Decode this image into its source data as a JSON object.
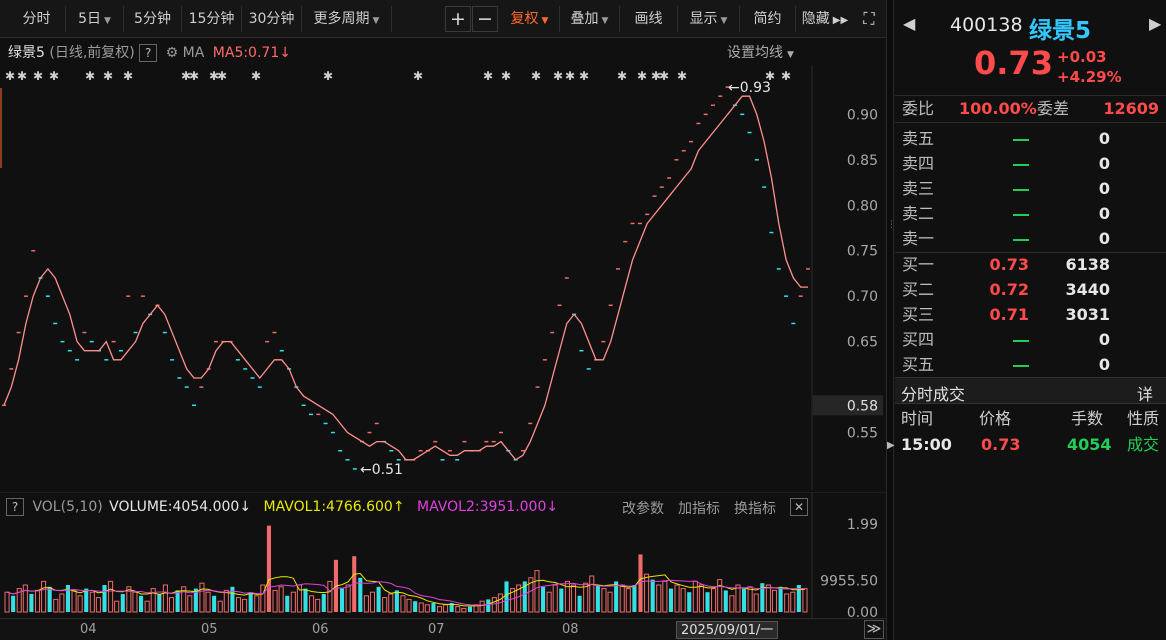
{
  "toolbar": {
    "fenshi": "分时",
    "period_5day": "5日",
    "min5": "5分钟",
    "min15": "15分钟",
    "min30": "30分钟",
    "more_periods": "更多周期",
    "zoom_in": "+",
    "zoom_out": "−",
    "fuquan": "复权",
    "overlay": "叠加",
    "draw_line": "画线",
    "display": "显示",
    "simple": "简约",
    "hide": "隐藏",
    "fullscreen_icon": "⛶"
  },
  "main_chart": {
    "stock_name": "绿景5",
    "period_info": "(日线,前复权)",
    "help": "?",
    "ma_label": "MA",
    "ma5_label": "MA5:0.71",
    "ma5_arrow": "↓",
    "set_ma": "设置均线",
    "high_label": "0.93",
    "low_label": "0.51",
    "current_price_tag": "0.58",
    "y_ticks": [
      "0.90",
      "0.85",
      "0.80",
      "0.75",
      "0.70",
      "0.65",
      "0.55"
    ],
    "y_range": [
      0.5,
      0.94
    ]
  },
  "volume_panel": {
    "help": "?",
    "vol_label": "VOL(5,10)",
    "volume": "VOLUME:4054.000",
    "volume_arrow": "↓",
    "mavol1": "MAVOL1:4766.600",
    "mavol1_arrow": "↑",
    "mavol2": "MAVOL2:3951.000",
    "mavol2_arrow": "↓",
    "modify_params": "改参数",
    "add_indicator": "加指标",
    "switch_indicator": "换指标",
    "close": "✕",
    "y_ticks": [
      "1.99",
      "9955.50",
      "0.00"
    ]
  },
  "time_axis": {
    "labels": [
      "04",
      "05",
      "06",
      "07",
      "08"
    ],
    "cursor_date": "2025/09/01/一",
    "scroll_right": "≫"
  },
  "quote": {
    "code": "400138",
    "name": "绿景5",
    "price": "0.73",
    "change": "+0.03",
    "change_pct": "+4.29%",
    "weibi_label": "委比",
    "weibi": "100.00%",
    "weicha_label": "委差",
    "weicha": "12609"
  },
  "order_book": {
    "sell": [
      {
        "label": "卖五",
        "volume": "0"
      },
      {
        "label": "卖四",
        "volume": "0"
      },
      {
        "label": "卖三",
        "volume": "0"
      },
      {
        "label": "卖二",
        "volume": "0"
      },
      {
        "label": "卖一",
        "volume": "0"
      }
    ],
    "buy": [
      {
        "label": "买一",
        "price": "0.73",
        "volume": "6138"
      },
      {
        "label": "买二",
        "price": "0.72",
        "volume": "3440"
      },
      {
        "label": "买三",
        "price": "0.71",
        "volume": "3031"
      },
      {
        "label": "买四",
        "volume": "0"
      },
      {
        "label": "买五",
        "volume": "0"
      }
    ]
  },
  "trades": {
    "title": "分时成交",
    "detail": "详",
    "headers": [
      "时间",
      "价格",
      "手数",
      "性质"
    ],
    "rows": [
      {
        "time": "15:00",
        "price": "0.73",
        "volume": "4054",
        "nature": "成交"
      }
    ]
  },
  "colors": {
    "up": "#ff4b4b",
    "down": "#22cc55",
    "ma5": "#ff8f8f",
    "mavol1": "#e8e800",
    "mavol2": "#e040e0",
    "volume_up": "#f06a6a",
    "volume_down": "#33e0e6"
  },
  "chart_data": {
    "type": "line",
    "title": "绿景5",
    "series": [
      {
        "name": "MA5",
        "values": [
          0.58,
          0.6,
          0.63,
          0.67,
          0.7,
          0.72,
          0.73,
          0.72,
          0.7,
          0.68,
          0.65,
          0.64,
          0.64,
          0.64,
          0.65,
          0.63,
          0.63,
          0.64,
          0.65,
          0.67,
          0.68,
          0.69,
          0.68,
          0.66,
          0.64,
          0.62,
          0.61,
          0.61,
          0.62,
          0.64,
          0.65,
          0.65,
          0.64,
          0.63,
          0.62,
          0.61,
          0.62,
          0.63,
          0.63,
          0.62,
          0.6,
          0.59,
          0.585,
          0.58,
          0.575,
          0.57,
          0.56,
          0.55,
          0.545,
          0.54,
          0.535,
          0.54,
          0.54,
          0.535,
          0.53,
          0.52,
          0.52,
          0.525,
          0.53,
          0.535,
          0.53,
          0.525,
          0.525,
          0.53,
          0.53,
          0.53,
          0.535,
          0.535,
          0.54,
          0.53,
          0.52,
          0.525,
          0.54,
          0.56,
          0.58,
          0.61,
          0.64,
          0.67,
          0.68,
          0.67,
          0.65,
          0.63,
          0.63,
          0.65,
          0.68,
          0.71,
          0.74,
          0.76,
          0.78,
          0.79,
          0.8,
          0.81,
          0.82,
          0.83,
          0.84,
          0.86,
          0.87,
          0.88,
          0.89,
          0.9,
          0.91,
          0.92,
          0.92,
          0.9,
          0.87,
          0.83,
          0.78,
          0.74,
          0.72,
          0.71,
          0.71
        ]
      }
    ],
    "ohlc_markers": [
      0.58,
      0.62,
      0.66,
      0.7,
      0.75,
      0.72,
      0.7,
      0.67,
      0.65,
      0.64,
      0.63,
      0.66,
      0.65,
      0.64,
      0.63,
      0.65,
      0.64,
      0.7,
      0.66,
      0.7,
      0.68,
      0.69,
      0.66,
      0.63,
      0.61,
      0.6,
      0.58,
      0.6,
      0.62,
      0.65,
      0.65,
      0.65,
      0.63,
      0.62,
      0.61,
      0.6,
      0.65,
      0.66,
      0.64,
      0.62,
      0.6,
      0.58,
      0.57,
      0.57,
      0.56,
      0.55,
      0.53,
      0.52,
      0.51,
      0.54,
      0.55,
      0.56,
      0.54,
      0.53,
      0.52,
      0.52,
      0.52,
      0.53,
      0.53,
      0.54,
      0.52,
      0.53,
      0.52,
      0.54,
      0.53,
      0.53,
      0.54,
      0.54,
      0.55,
      0.53,
      0.52,
      0.53,
      0.56,
      0.6,
      0.63,
      0.66,
      0.69,
      0.72,
      0.68,
      0.64,
      0.62,
      0.63,
      0.65,
      0.69,
      0.73,
      0.76,
      0.78,
      0.78,
      0.79,
      0.81,
      0.82,
      0.83,
      0.85,
      0.86,
      0.87,
      0.89,
      0.9,
      0.91,
      0.92,
      0.93,
      0.91,
      0.9,
      0.88,
      0.85,
      0.82,
      0.77,
      0.73,
      0.7,
      0.67,
      0.7,
      0.73
    ],
    "volume": [
      22,
      18,
      26,
      30,
      20,
      24,
      34,
      28,
      14,
      20,
      30,
      24,
      18,
      26,
      22,
      16,
      30,
      34,
      12,
      20,
      28,
      22,
      18,
      12,
      26,
      20,
      30,
      16,
      24,
      28,
      18,
      26,
      32,
      22,
      18,
      12,
      24,
      28,
      16,
      14,
      22,
      18,
      30,
      96,
      24,
      28,
      18,
      22,
      30,
      26,
      18,
      14,
      20,
      34,
      58,
      26,
      30,
      62,
      38,
      18,
      22,
      28,
      16,
      20,
      24,
      18,
      14,
      12,
      10,
      8,
      10,
      6,
      8,
      10,
      6,
      4,
      6,
      8,
      12,
      14,
      16,
      20,
      34,
      26,
      30,
      34,
      38,
      46,
      28,
      22,
      30,
      26,
      34,
      30,
      18,
      32,
      40,
      30,
      26,
      22,
      34,
      30,
      26,
      30,
      64,
      42,
      36,
      30,
      34,
      26,
      30,
      26,
      22,
      34,
      30,
      22,
      26,
      36,
      24,
      18,
      30,
      26,
      28,
      20,
      32,
      30,
      24,
      28,
      20,
      22,
      30,
      26
    ],
    "ylim": [
      0.5,
      0.94
    ]
  }
}
